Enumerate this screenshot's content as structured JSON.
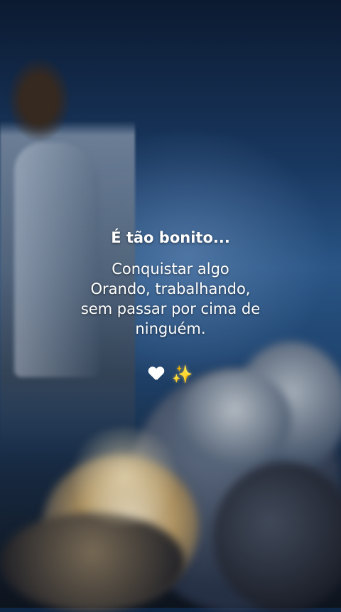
{
  "post": {
    "headline": "É tão bonito...",
    "lines": [
      "Conquistar algo",
      "Orando, trabalhando,",
      "sem passar por cima de",
      "ninguém."
    ],
    "emoji": {
      "heart": "white-heart-icon",
      "sparkles": "sparkles-icon",
      "sparkles_char": "✨"
    }
  }
}
